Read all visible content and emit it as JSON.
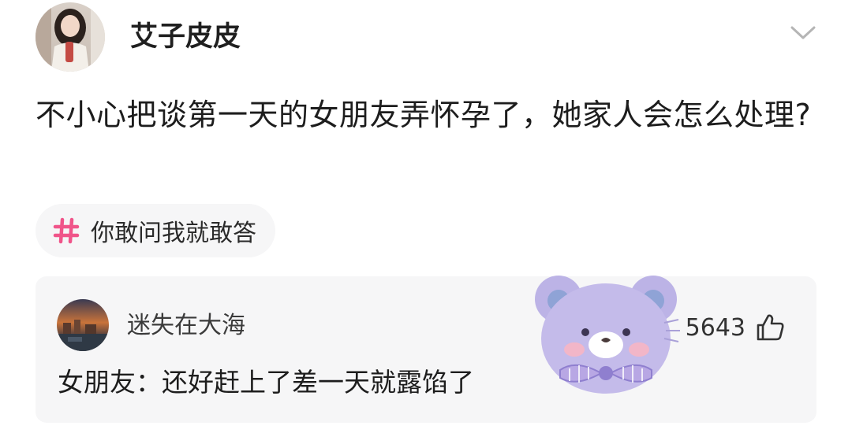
{
  "post": {
    "author": {
      "name": "艾子皮皮",
      "avatar_icon": "user-avatar-photo"
    },
    "menu_icon": "chevron-down-icon",
    "question": "不小心把谈第一天的女朋友弄怀孕了，她家人会怎么处理?"
  },
  "topic": {
    "icon": "hash-icon",
    "label": "你敢问我就敢答",
    "icon_color": "#f0558a"
  },
  "comment": {
    "author": "迷失在大海",
    "avatar_icon": "sunset-avatar-photo",
    "likes": "5643",
    "like_icon": "thumbs-up-icon",
    "text": "女朋友：还好赶上了差一天就露馅了",
    "sticker": "purple-bear-sticker"
  },
  "colors": {
    "card_bg": "#f6f6f7",
    "text": "#1d1d1d",
    "bear": "#bcb3e6"
  }
}
